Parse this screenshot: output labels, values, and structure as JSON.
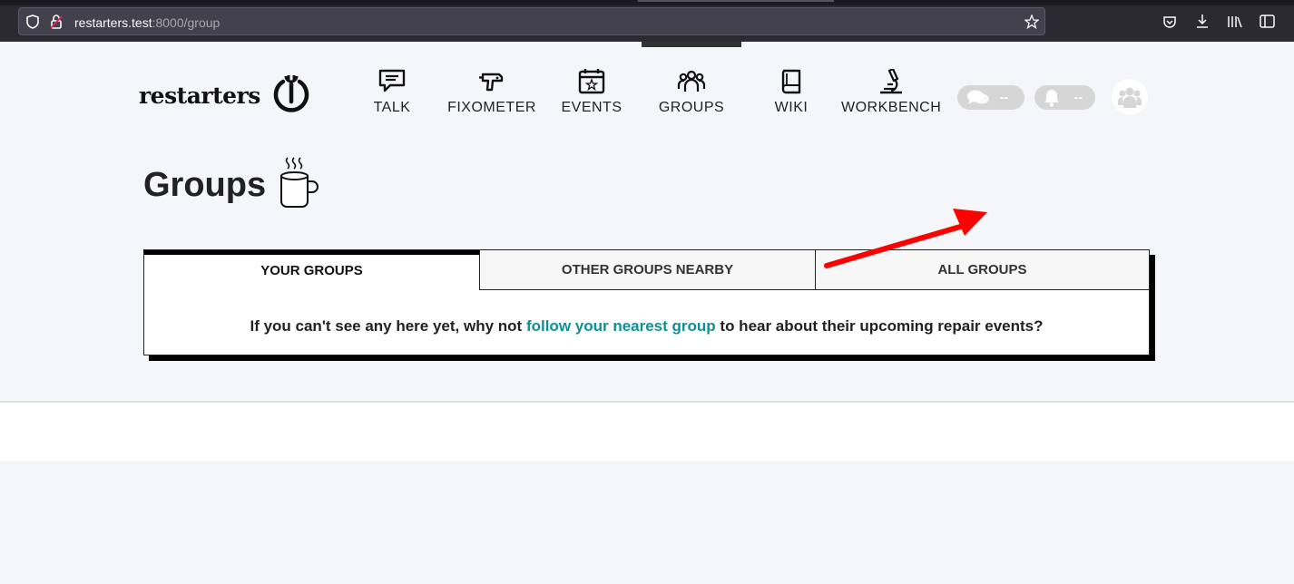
{
  "browser": {
    "url_host": "restarters.test",
    "url_path": ":8000/group"
  },
  "logo": {
    "text": "restarters"
  },
  "nav": [
    {
      "label": "TALK",
      "icon": "chat-icon"
    },
    {
      "label": "FIXOMETER",
      "icon": "drill-icon"
    },
    {
      "label": "EVENTS",
      "icon": "calendar-icon"
    },
    {
      "label": "GROUPS",
      "icon": "people-icon"
    },
    {
      "label": "WIKI",
      "icon": "book-icon"
    },
    {
      "label": "WORKBENCH",
      "icon": "microscope-icon"
    }
  ],
  "header": {
    "talk_count": "--",
    "notification_count": "--"
  },
  "page": {
    "title": "Groups"
  },
  "tabs": [
    {
      "label": "YOUR GROUPS",
      "active": true
    },
    {
      "label": "OTHER GROUPS NEARBY",
      "active": false
    },
    {
      "label": "ALL GROUPS",
      "active": false
    }
  ],
  "panel": {
    "msg_before": "If you can't see any here yet, why not ",
    "msg_link": "follow your nearest group",
    "msg_after": " to hear about their upcoming repair events?"
  },
  "colors": {
    "link": "#0e9096",
    "annotation_arrow": "#ff0000"
  }
}
